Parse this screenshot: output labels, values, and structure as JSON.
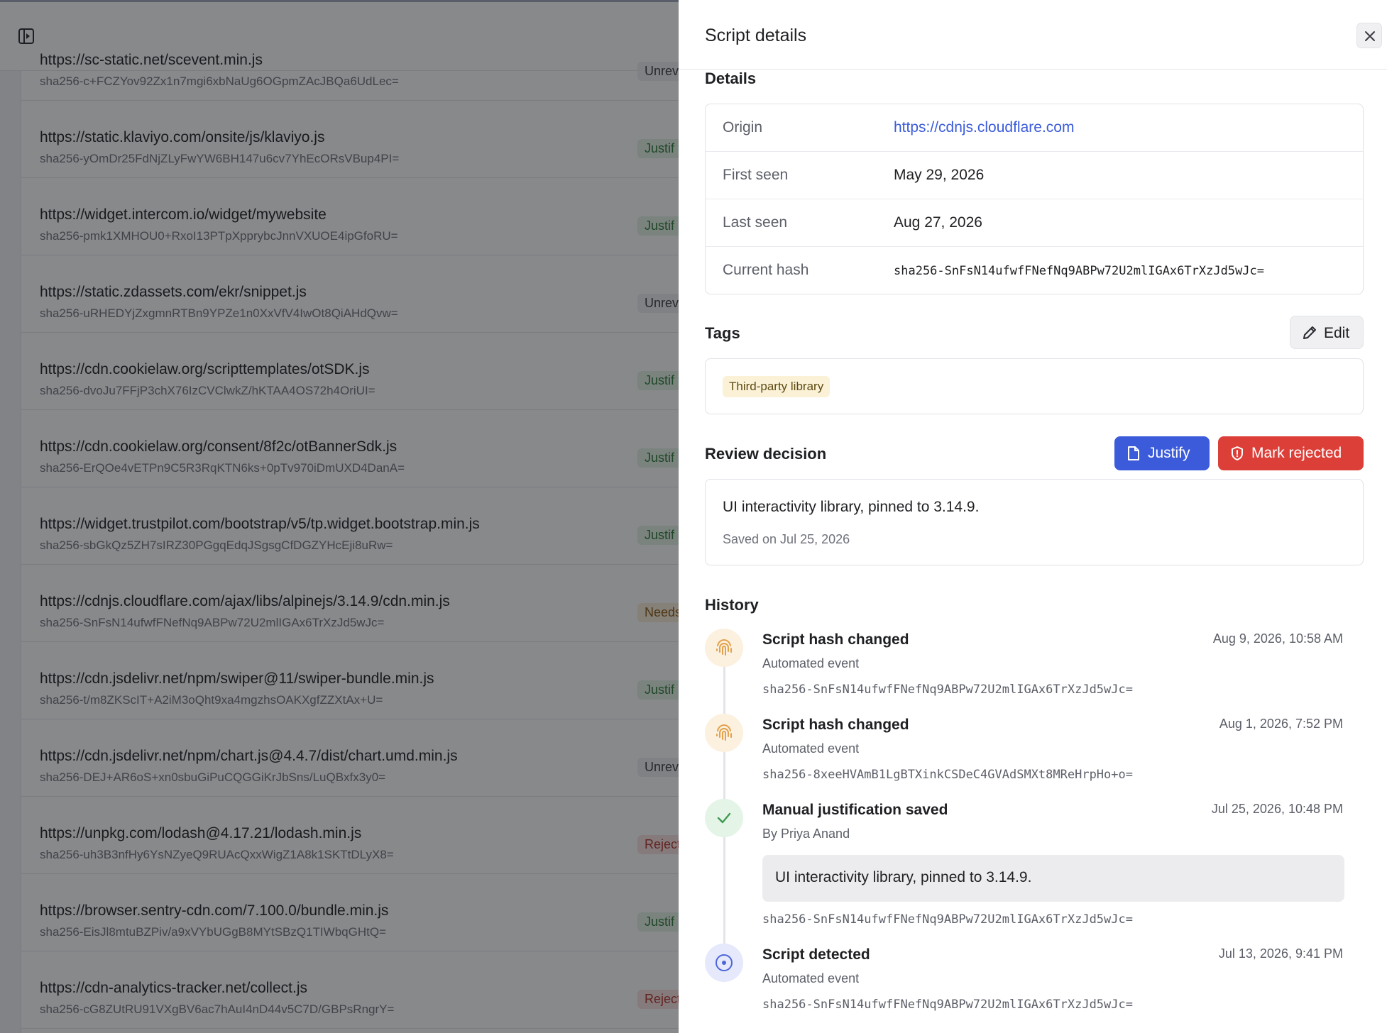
{
  "scripts": [
    {
      "url": "https://sc-static.net/scevent.min.js",
      "hash": "sha256-c+FCZYov92Zx1n7mgi6xbNaUg6OGpmZAcJBQa6UdLec=",
      "status": "Unrev"
    },
    {
      "url": "https://static.klaviyo.com/onsite/js/klaviyo.js",
      "hash": "sha256-yOmDr25FdNjZLyFwYW6BH147u6cv7YhEcORsVBup4PI=",
      "status": "Justif"
    },
    {
      "url": "https://widget.intercom.io/widget/mywebsite",
      "hash": "sha256-pmk1XMHOU0+RxoI13PTpXpprybcJnnVXUOE4ipGfoRU=",
      "status": "Justif"
    },
    {
      "url": "https://static.zdassets.com/ekr/snippet.js",
      "hash": "sha256-uRHEDYjZxgmnRTBn9YPZe1n0XxVfV4IwOt8QiAHdQvw=",
      "status": "Unrev"
    },
    {
      "url": "https://cdn.cookielaw.org/scripttemplates/otSDK.js",
      "hash": "sha256-dvoJu7FFjP3chX76IzCVClwkZ/hKTAA4OS72h4OriUI=",
      "status": "Justif"
    },
    {
      "url": "https://cdn.cookielaw.org/consent/8f2c/otBannerSdk.js",
      "hash": "sha256-ErQOe4vETPn9C5R3RqKTN6ks+0pTv970iDmUXD4DanA=",
      "status": "Justif"
    },
    {
      "url": "https://widget.trustpilot.com/bootstrap/v5/tp.widget.bootstrap.min.js",
      "hash": "sha256-sbGkQz5ZH7sIRZ30PGgqEdqJSgsgCfDGZYHcEji8uRw=",
      "status": "Justif"
    },
    {
      "url": "https://cdnjs.cloudflare.com/ajax/libs/alpinejs/3.14.9/cdn.min.js",
      "hash": "sha256-SnFsN14ufwfFNefNq9ABPw72U2mlIGAx6TrXzJd5wJc=",
      "status": "Needs"
    },
    {
      "url": "https://cdn.jsdelivr.net/npm/swiper@11/swiper-bundle.min.js",
      "hash": "sha256-t/m8ZKScIT+A2iM3oQht9xa4mgzhsOAKXgfZZXtAx+U=",
      "status": "Justif"
    },
    {
      "url": "https://cdn.jsdelivr.net/npm/chart.js@4.4.7/dist/chart.umd.min.js",
      "hash": "sha256-DEJ+AR6oS+xn0sbuGiPuCQGGiKrJbSns/LuQBxfx3y0=",
      "status": "Unrev"
    },
    {
      "url": "https://unpkg.com/lodash@4.17.21/lodash.min.js",
      "hash": "sha256-uh3B3nfHy6YsNZyeQ9RUAcQxxWigZ1A8k1SKTtDLyX8=",
      "status": "Reject"
    },
    {
      "url": "https://browser.sentry-cdn.com/7.100.0/bundle.min.js",
      "hash": "sha256-EisJl8mtuBZPiv/a9xVYbUGgB8MYtSBzQ1TIWbqGHtQ=",
      "status": "Justif"
    },
    {
      "url": "https://cdn-analytics-tracker.net/collect.js",
      "hash": "sha256-cG8ZUtRU91VXgBV6ac7hAuI4nD44v5C7D/GBPsRngrY=",
      "status": "Reject"
    }
  ],
  "drawer": {
    "title": "Script details",
    "details": {
      "heading": "Details",
      "origin_label": "Origin",
      "origin_value": "https://cdnjs.cloudflare.com",
      "first_seen_label": "First seen",
      "first_seen_value": "May 29, 2026",
      "last_seen_label": "Last seen",
      "last_seen_value": "Aug 27, 2026",
      "hash_label": "Current hash",
      "hash_value": "sha256-SnFsN14ufwfFNefNq9ABPw72U2mlIGAx6TrXzJd5wJc="
    },
    "tags": {
      "heading": "Tags",
      "edit_label": "Edit",
      "items": [
        "Third-party library"
      ]
    },
    "review": {
      "heading": "Review decision",
      "justify_label": "Justify",
      "reject_label": "Mark rejected",
      "text": "UI interactivity library, pinned to 3.14.9.",
      "saved": "Saved on Jul 25, 2026"
    },
    "history": {
      "heading": "History",
      "events": [
        {
          "title": "Script hash changed",
          "sub": "Automated event",
          "hash": "sha256-SnFsN14ufwfFNefNq9ABPw72U2mlIGAx6TrXzJd5wJc=",
          "time": "Aug 9, 2026, 10:58 AM",
          "icon": "fingerprint-icon"
        },
        {
          "title": "Script hash changed",
          "sub": "Automated event",
          "hash": "sha256-8xeeHVAmB1LgBTXinkCSDeC4GVAdSMXt8MReHrpHo+o=",
          "time": "Aug 1, 2026, 7:52 PM",
          "icon": "fingerprint-icon"
        },
        {
          "title": "Manual justification saved",
          "sub": "By Priya Anand",
          "note": "UI interactivity library, pinned to 3.14.9.",
          "hash": "sha256-SnFsN14ufwfFNefNq9ABPw72U2mlIGAx6TrXzJd5wJc=",
          "time": "Jul 25, 2026, 10:48 PM",
          "icon": "check-icon"
        },
        {
          "title": "Script detected",
          "sub": "Automated event",
          "hash": "sha256-SnFsN14ufwfFNefNq9ABPw72U2mlIGAx6TrXzJd5wJc=",
          "time": "Jul 13, 2026, 9:41 PM",
          "icon": "target-icon"
        }
      ]
    }
  },
  "colors": {
    "accent": "#3b5bdb",
    "danger": "#dc3f38",
    "tag_bg": "#faf1d6"
  }
}
